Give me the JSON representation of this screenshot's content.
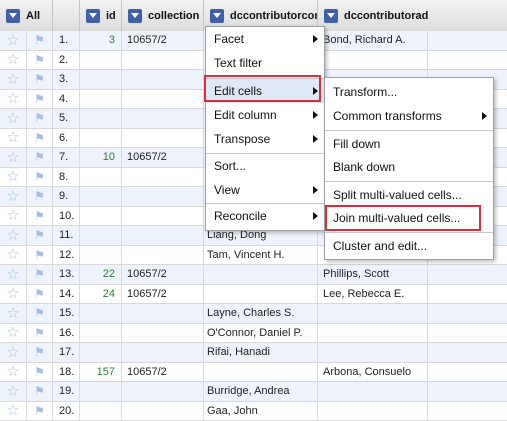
{
  "header": {
    "all_label": "All",
    "columns": [
      "id",
      "collection",
      "dccontributorcom",
      "dccontributorad"
    ]
  },
  "rows": [
    {
      "n": "1.",
      "id": "3",
      "collection": "10657/2",
      "dc1": "",
      "dc2": "Bond, Richard A."
    },
    {
      "n": "2.",
      "id": "",
      "collection": "",
      "dc1": "",
      "dc2": ""
    },
    {
      "n": "3.",
      "id": "",
      "collection": "",
      "dc1": "",
      "dc2": ""
    },
    {
      "n": "4.",
      "id": "",
      "collection": "",
      "dc1": "",
      "dc2": ""
    },
    {
      "n": "5.",
      "id": "",
      "collection": "",
      "dc1": "",
      "dc2": ""
    },
    {
      "n": "6.",
      "id": "",
      "collection": "",
      "dc1": "",
      "dc2": ""
    },
    {
      "n": "7.",
      "id": "10",
      "collection": "10657/2",
      "dc1": "",
      "dc2": ""
    },
    {
      "n": "8.",
      "id": "",
      "collection": "",
      "dc1": "",
      "dc2": ""
    },
    {
      "n": "9.",
      "id": "",
      "collection": "",
      "dc1": "",
      "dc2": ""
    },
    {
      "n": "10.",
      "id": "",
      "collection": "",
      "dc1": "",
      "dc2": ""
    },
    {
      "n": "11.",
      "id": "",
      "collection": "",
      "dc1": "Liang, Dong",
      "dc2": ""
    },
    {
      "n": "12.",
      "id": "",
      "collection": "",
      "dc1": "Tam, Vincent H.",
      "dc2": ""
    },
    {
      "n": "13.",
      "id": "22",
      "collection": "10657/2",
      "dc1": "",
      "dc2": "Phillips, Scott"
    },
    {
      "n": "14.",
      "id": "24",
      "collection": "10657/2",
      "dc1": "",
      "dc2": "Lee, Rebecca E."
    },
    {
      "n": "15.",
      "id": "",
      "collection": "",
      "dc1": "Layne, Charles S.",
      "dc2": ""
    },
    {
      "n": "16.",
      "id": "",
      "collection": "",
      "dc1": "O'Connor, Daniel P.",
      "dc2": ""
    },
    {
      "n": "17.",
      "id": "",
      "collection": "",
      "dc1": "Rifai, Hanadi",
      "dc2": ""
    },
    {
      "n": "18.",
      "id": "157",
      "collection": "10657/2",
      "dc1": "",
      "dc2": "Arbona, Consuelo"
    },
    {
      "n": "19.",
      "id": "",
      "collection": "",
      "dc1": "Burridge, Andrea",
      "dc2": ""
    },
    {
      "n": "20.",
      "id": "",
      "collection": "",
      "dc1": "Gaa, John",
      "dc2": ""
    }
  ],
  "menu": {
    "items": [
      "Facet",
      "Text filter",
      "Edit cells",
      "Edit column",
      "Transpose",
      "Sort...",
      "View",
      "Reconcile"
    ]
  },
  "submenu": {
    "items": [
      "Transform...",
      "Common transforms",
      "Fill down",
      "Blank down",
      "Split multi-valued cells...",
      "Join multi-valued cells...",
      "Cluster and edit..."
    ]
  },
  "icons": {
    "star": "star-icon",
    "flag": "flag-icon",
    "dropdown": "dropdown-icon"
  },
  "colors": {
    "highlight_box": "#d32f3c",
    "id_text": "#2e7d32",
    "header_button": "#3f5fa7"
  }
}
